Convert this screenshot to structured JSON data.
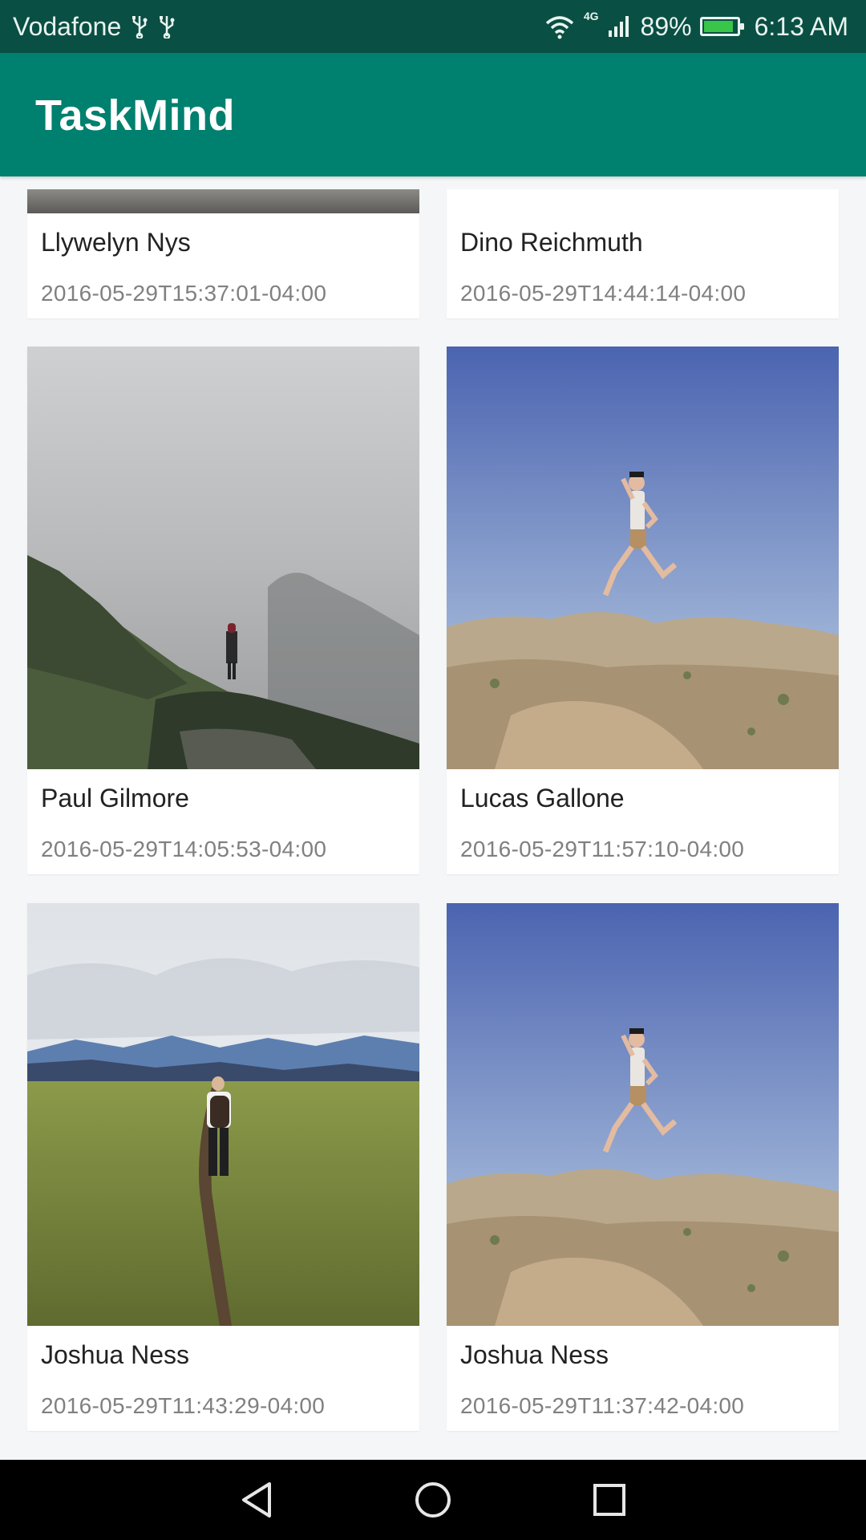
{
  "status_bar": {
    "carrier": "Vodafone",
    "network": "4G",
    "battery_percent": "89%",
    "time": "6:13 AM",
    "battery_level": 0.89,
    "icons": [
      "usb-icon",
      "usb-icon",
      "wifi-icon",
      "signal-icon",
      "battery-icon"
    ]
  },
  "app_bar": {
    "title": "TaskMind"
  },
  "cards": [
    {
      "name": "Llywelyn Nys",
      "date": "2016-05-29T15:37:01-04:00"
    },
    {
      "name": "Dino Reichmuth",
      "date": "2016-05-29T14:44:14-04:00"
    },
    {
      "name": "Paul Gilmore",
      "date": "2016-05-29T14:05:53-04:00"
    },
    {
      "name": "Lucas Gallone",
      "date": "2016-05-29T11:57:10-04:00"
    },
    {
      "name": "Joshua Ness",
      "date": "2016-05-29T11:43:29-04:00"
    },
    {
      "name": "Joshua Ness",
      "date": "2016-05-29T11:37:42-04:00"
    }
  ],
  "nav_bar": {
    "icons": [
      "back-icon",
      "home-icon",
      "recents-icon"
    ]
  },
  "colors": {
    "app_bar": "#00806e",
    "status_bar": "#0a4f43"
  }
}
